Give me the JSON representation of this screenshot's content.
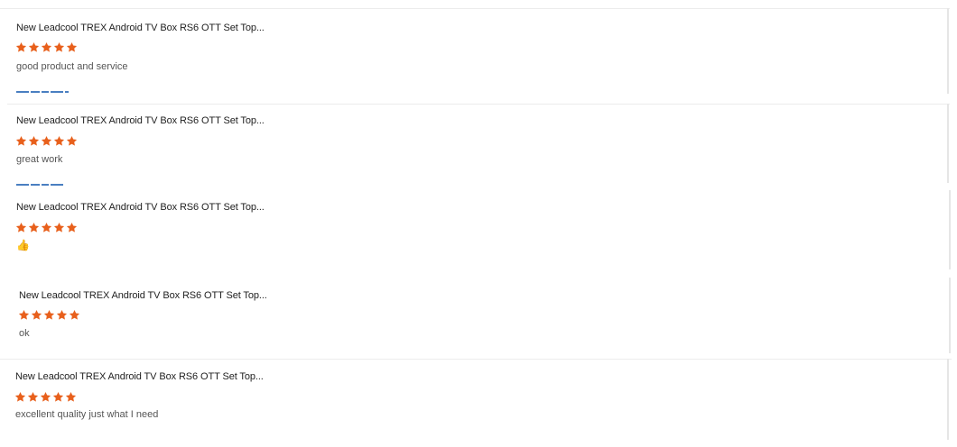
{
  "reviews": [
    {
      "product_title": "New Leadcool TREX Android TV Box RS6 OTT Set Top...",
      "rating": 5,
      "rating_max": 5,
      "comment": "good product and service",
      "has_photo_thumbnails": true
    },
    {
      "product_title": "New Leadcool TREX Android TV Box RS6 OTT Set Top...",
      "rating": 5,
      "rating_max": 5,
      "comment": "great work",
      "has_photo_thumbnails": true
    },
    {
      "product_title": "New Leadcool TREX Android TV Box RS6 OTT Set Top...",
      "rating": 5,
      "rating_max": 5,
      "comment": "👍",
      "has_photo_thumbnails": false
    },
    {
      "product_title": "New Leadcool TREX Android TV Box RS6 OTT Set Top...",
      "rating": 5,
      "rating_max": 5,
      "comment": "ok",
      "has_photo_thumbnails": false
    },
    {
      "product_title": "New Leadcool TREX Android TV Box RS6 OTT Set Top...",
      "rating": 5,
      "rating_max": 5,
      "comment": "excellent quality just what I need",
      "has_photo_thumbnails": false
    }
  ],
  "colors": {
    "star": "#e8601c",
    "title": "#222222",
    "comment": "#555555"
  },
  "icons": {
    "star": "star-icon",
    "thumbs_up": "thumbs-up-emoji"
  }
}
